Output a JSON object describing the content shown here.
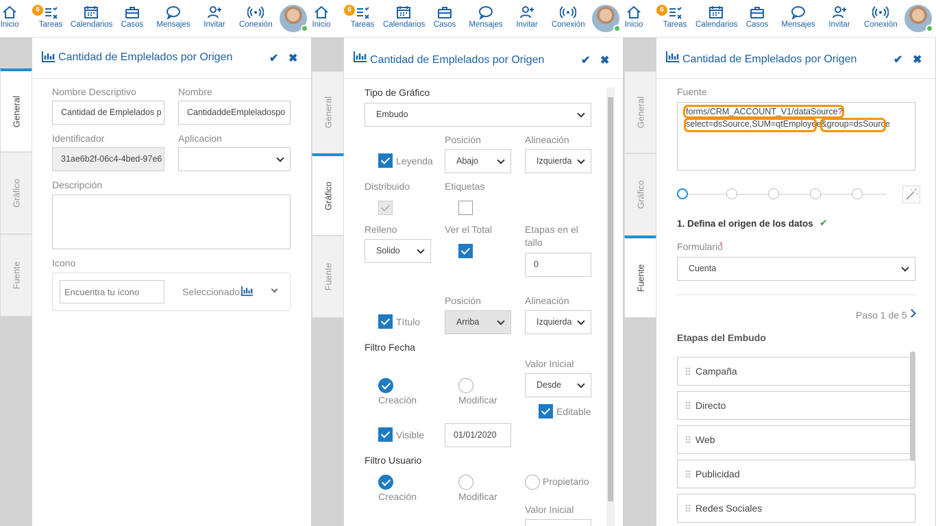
{
  "topbar": {
    "items": [
      "Inicio",
      "Tareas",
      "Calendarios",
      "Casos",
      "Mensajes",
      "Invitar",
      "Conexión"
    ],
    "badge": "6"
  },
  "tabs": {
    "general": "General",
    "grafico": "Gráfico",
    "fuente": "Fuente"
  },
  "card": {
    "title": "Cantidad de Emplelados por Origen"
  },
  "general": {
    "nombre_descriptivo_label": "Nombre Descriptivo",
    "nombre_descriptivo_value": "Cantidad de Emplelados p",
    "nombre_label": "Nombre",
    "nombre_value": "CantidaddeEmpleladospo",
    "identificador_label": "Identificador",
    "identificador_value": "31ae6b2f-06c4-4bed-97e6",
    "aplicacion_label": "Aplicacion",
    "aplicacion_value": "",
    "descripcion_label": "Descripción",
    "icono_label": "Icono",
    "icono_placeholder": "Encuentra tu ícono",
    "seleccionado_label": "Seleccionado:"
  },
  "grafico": {
    "tipo_label": "Tipo de Gráfico",
    "tipo_value": "Embudo",
    "posicion_label": "Posición",
    "alineacion_label": "Alineación",
    "leyenda_label": "Leyenda",
    "leyenda_pos": "Abajo",
    "leyenda_alin": "Izquierda",
    "distribuido_label": "Distribuido",
    "etiquetas_label": "Etiquetas",
    "relleno_label": "Relleno",
    "relleno_value": "Solido",
    "ver_total_label": "Ver el Total",
    "etapas_label_1": "Etapas en el",
    "etapas_label_2": "tallo",
    "etapas_value": "0",
    "titulo_label": "Título",
    "titulo_pos": "Arriba",
    "titulo_alin": "Izquierda",
    "filtro_fecha_label": "Filtro Fecha",
    "valor_inicial_label": "Valor Inicial",
    "creacion_label": "Creación",
    "modificar_label": "Modificar",
    "desde_value": "Desde",
    "editable_label": "Editable",
    "visible_label": "Visible",
    "fecha_value": "01/01/2020",
    "filtro_usuario_label": "Filtro Usuario",
    "propietario_label": "Propietario"
  },
  "fuente": {
    "fuente_label": "Fuente",
    "fuente_line1": "forms/CRM_ACCOUNT_V1/dataSource?",
    "fuente_line2": "select=dsSource,SUM=qtEmployee&group=dsSource",
    "step_title": "1. Defina el origen de los datos",
    "formulario_label": "Formulario",
    "required_mark": "*",
    "formulario_value": "Cuenta",
    "paso": "Paso 1 de 5",
    "etapas_label": "Etapas del Embudo",
    "etapas": [
      "Campaña",
      "Directo",
      "Web",
      "Publicidad",
      "Redes Sociales"
    ]
  },
  "colors": {
    "accent": "#1d61a6",
    "highlight": "#f39200",
    "badge": "#f39c12",
    "tab_active": "#1e8fd6"
  },
  "icons": [
    "home-icon",
    "tasks-icon",
    "calendar-icon",
    "briefcase-icon",
    "chat-icon",
    "add-user-icon",
    "wifi-icon",
    "chart-icon",
    "check-icon",
    "close-icon",
    "chevron-down-icon",
    "chevron-right-icon",
    "wand-icon",
    "drag-handle-icon"
  ]
}
